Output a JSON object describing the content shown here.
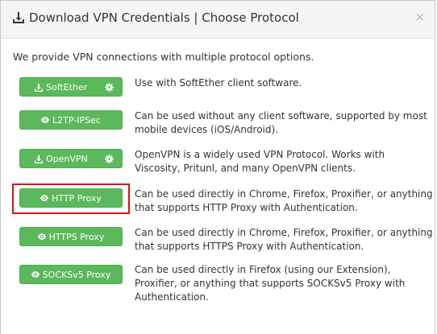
{
  "modal": {
    "title_icon": "download-icon",
    "title": "Download VPN Credentials | Choose Protocol",
    "close": "×",
    "intro": "We provide VPN connections with multiple protocol options."
  },
  "protocols": [
    {
      "button_label": "SoftEther",
      "button_icon": "download-icon",
      "has_settings": true,
      "description": "Use with SoftEther client software."
    },
    {
      "button_label": "L2TP-IPSec",
      "button_icon": "eye-icon",
      "has_settings": false,
      "description": "Can be used without any client software, supported by most mobile devices (iOS/Android)."
    },
    {
      "button_label": "OpenVPN",
      "button_icon": "download-icon",
      "has_settings": true,
      "description": "OpenVPN is a widely used VPN Protocol. Works with Viscosity, Pritunl, and many OpenVPN clients."
    },
    {
      "button_label": "HTTP Proxy",
      "button_icon": "eye-icon",
      "has_settings": false,
      "highlighted": true,
      "description": "Can be used directly in Chrome, Firefox, Proxifier, or anything that supports HTTP Proxy with Authentication."
    },
    {
      "button_label": "HTTPS Proxy",
      "button_icon": "eye-icon",
      "has_settings": false,
      "description": "Can be used directly in Chrome, Firefox, Proxifier, or anything that supports HTTPS Proxy with Authentication."
    },
    {
      "button_label": "SOCKSv5 Proxy",
      "button_icon": "eye-icon",
      "has_settings": false,
      "description": "Can be used directly in Firefox (using our Extension), Proxifier, or anything that supports SOCKSv5 Proxy with Authentication."
    }
  ],
  "colors": {
    "button_green": "#5cb85c",
    "highlight_red": "#e01010"
  }
}
